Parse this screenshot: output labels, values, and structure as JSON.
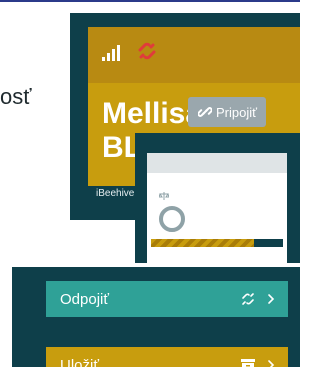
{
  "page": {
    "heading_fragment": "osť"
  },
  "device": {
    "name": "Mellisa BL",
    "connect_label": "Pripojiť",
    "description": "iBeehive zariaden",
    "colors": {
      "dark": "#0e3f4a",
      "gold": "#c89d0e",
      "gold_header": "#b88a12",
      "disconnect_red": "#e03b3b"
    },
    "icons": [
      "signal-icon",
      "link-broken-icon",
      "link-icon"
    ]
  },
  "preview": {
    "progress_fraction": 0.78,
    "icons": [
      "scale-icon",
      "ring-gauge"
    ]
  },
  "actions": {
    "disconnect_label": "Odpojiť",
    "save_label": "Uložiť",
    "colors": {
      "teal": "#2fa197",
      "gold": "#c89d0e"
    },
    "icons": [
      "unlink-icon",
      "archive-icon",
      "chevron-right-icon"
    ]
  }
}
